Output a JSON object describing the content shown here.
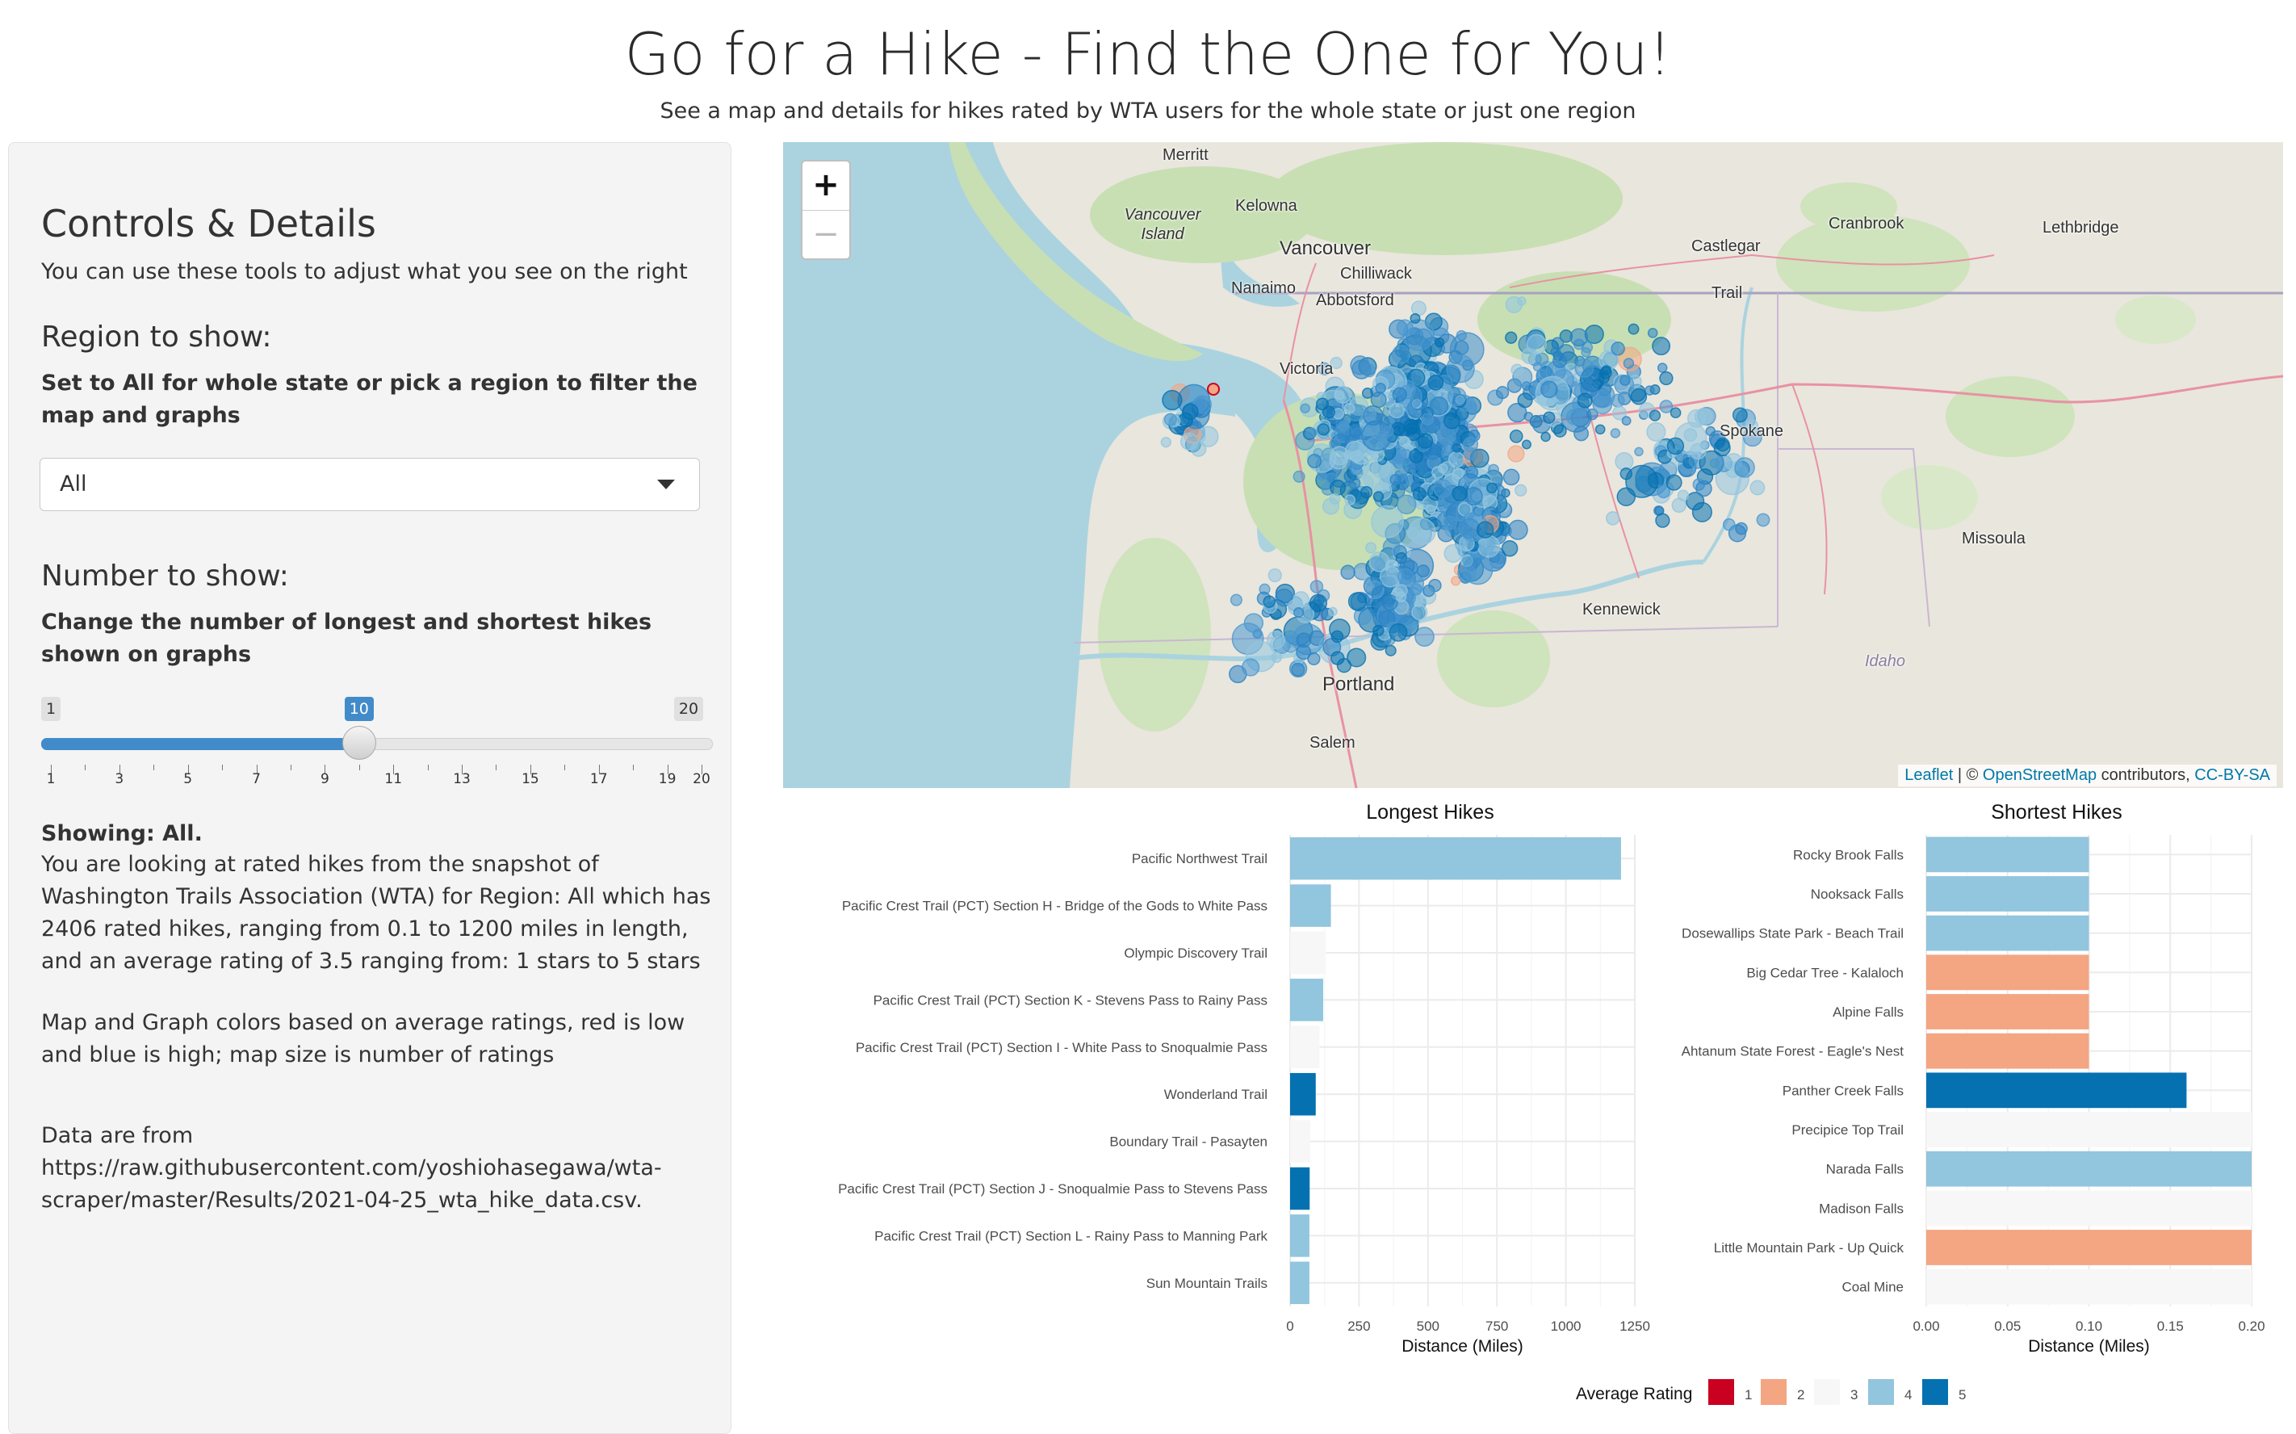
{
  "header": {
    "title": "Go for a Hike - Find the One for You!",
    "subtitle": "See a map and details for hikes rated by WTA users for the whole state or just one region"
  },
  "sidebar": {
    "heading": "Controls & Details",
    "intro": "You can use these tools to adjust what you see on the right",
    "region": {
      "heading": "Region to show:",
      "label": "Set to All for whole state or pick a region to filter the map and graphs",
      "selected": "All"
    },
    "number": {
      "heading": "Number to show:",
      "label": "Change the number of longest and shortest hikes shown on graphs",
      "min": "1",
      "max": "20",
      "value": "10",
      "value_num": 10,
      "ticks": [
        "1",
        "3",
        "5",
        "7",
        "9",
        "11",
        "13",
        "15",
        "17",
        "19",
        "20"
      ]
    },
    "showing_label": "Showing: All.",
    "details": "You are looking at rated hikes from the snapshot of Washington Trails Association (WTA) for Region: All which has 2406 rated hikes, ranging from 0.1 to 1200 miles in length, and an average rating of 3.5 ranging from: 1 stars to 5 stars",
    "colors_note": "Map and Graph colors based on average ratings, red is low and blue is high; map size is number of ratings",
    "data_from_label": "Data are from",
    "data_url": "https://raw.githubusercontent.com/yoshiohasegawa/wta-scraper/master/Results/2021-04-25_wta_hike_data.csv."
  },
  "map": {
    "zoom_in": "+",
    "zoom_out": "−",
    "attribution": {
      "leaflet": "Leaflet",
      "sep": " | © ",
      "osm": "OpenStreetMap",
      "contrib": " contributors, ",
      "license": "CC-BY-SA"
    },
    "labels": [
      "Merritt",
      "Kelowna",
      "Vancouver Island",
      "Vancouver",
      "Castlegar",
      "Cranbrook",
      "Lethbridge",
      "Chilliwack",
      "Nanaimo",
      "Abbotsford",
      "Trail",
      "Victoria",
      "Spokane",
      "Missoula",
      "Kennewick",
      "Idaho",
      "Portland",
      "Salem"
    ]
  },
  "chart_data": [
    {
      "type": "bar",
      "orientation": "horizontal",
      "title": "Longest Hikes",
      "xlabel": "Distance (Miles)",
      "xlim": [
        0,
        1250
      ],
      "xticks": [
        "0",
        "250",
        "500",
        "750",
        "1000",
        "1250"
      ],
      "categories": [
        "Pacific Northwest Trail",
        "Pacific Crest Trail (PCT) Section H - Bridge of the Gods to White Pass",
        "Olympic Discovery Trail",
        "Pacific Crest Trail (PCT) Section K - Stevens Pass to Rainy Pass",
        "Pacific Crest Trail (PCT) Section I - White Pass to Snoqualmie Pass",
        "Wonderland Trail",
        "Boundary Trail - Pasayten",
        "Pacific Crest Trail (PCT) Section J - Snoqualmie Pass to Stevens Pass",
        "Pacific Crest Trail (PCT) Section L - Rainy Pass to Manning Park",
        "Sun Mountain Trails"
      ],
      "values": [
        1200,
        148,
        130,
        120,
        107,
        93,
        73,
        71,
        70,
        70
      ],
      "rating": [
        4,
        4,
        3,
        4,
        3,
        5,
        3,
        5,
        4,
        4
      ]
    },
    {
      "type": "bar",
      "orientation": "horizontal",
      "title": "Shortest Hikes",
      "xlabel": "Distance (Miles)",
      "xlim": [
        0,
        0.2
      ],
      "xticks": [
        "0.00",
        "0.05",
        "0.10",
        "0.15",
        "0.20"
      ],
      "categories": [
        "Rocky Brook Falls",
        "Nooksack Falls",
        "Dosewallips State Park - Beach Trail",
        "Big Cedar Tree - Kalaloch",
        "Alpine Falls",
        "Ahtanum State Forest - Eagle's Nest",
        "Panther Creek Falls",
        "Precipice Top Trail",
        "Narada Falls",
        "Madison Falls",
        "Little Mountain Park - Up Quick",
        "Coal Mine"
      ],
      "values": [
        0.1,
        0.1,
        0.1,
        0.1,
        0.1,
        0.1,
        0.16,
        0.2,
        0.2,
        0.2,
        0.2,
        0.2
      ],
      "rating": [
        4,
        4,
        4,
        2,
        2,
        2,
        5,
        3,
        4,
        3,
        2,
        3
      ]
    }
  ],
  "legend": {
    "title": "Average Rating",
    "items": [
      "1",
      "2",
      "3",
      "4",
      "5"
    ],
    "colors": [
      "#ca0020",
      "#f4a582",
      "#f7f7f7",
      "#92c5de",
      "#0571b0"
    ]
  }
}
